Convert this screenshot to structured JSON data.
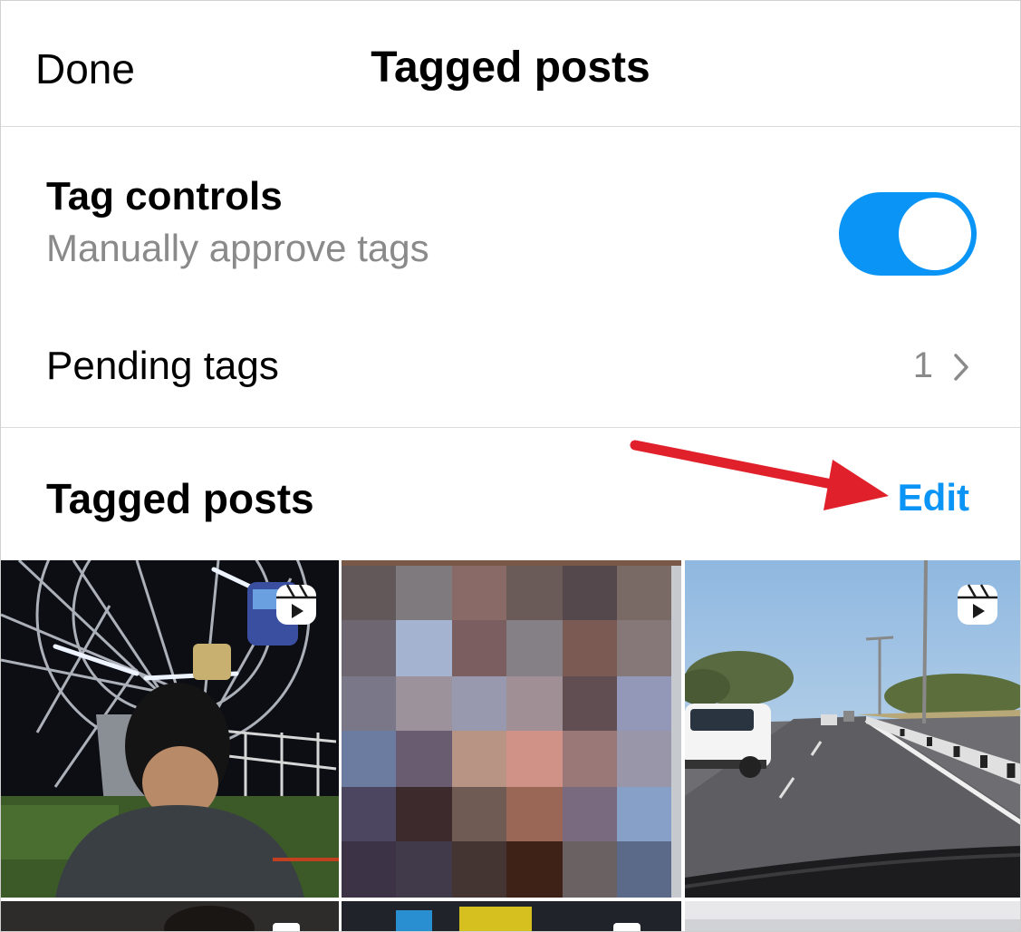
{
  "header": {
    "done_label": "Done",
    "title": "Tagged posts"
  },
  "tag_controls": {
    "title": "Tag controls",
    "subtitle": "Manually approve tags",
    "toggle_on": true
  },
  "pending_tags": {
    "label": "Pending tags",
    "count": "1"
  },
  "tagged_posts": {
    "title": "Tagged posts",
    "edit_label": "Edit"
  },
  "grid": {
    "tiles": [
      {
        "name": "ferris-wheel-reel",
        "type": "reel"
      },
      {
        "name": "pixelated-post",
        "type": "image"
      },
      {
        "name": "highway-reel",
        "type": "reel"
      }
    ]
  },
  "colors": {
    "accent": "#0a95f6",
    "annotation_arrow": "#e0202a",
    "secondary_text": "#8a8a8a"
  },
  "icons": [
    "chevron-right-icon",
    "reel-icon",
    "arrow-annotation"
  ]
}
